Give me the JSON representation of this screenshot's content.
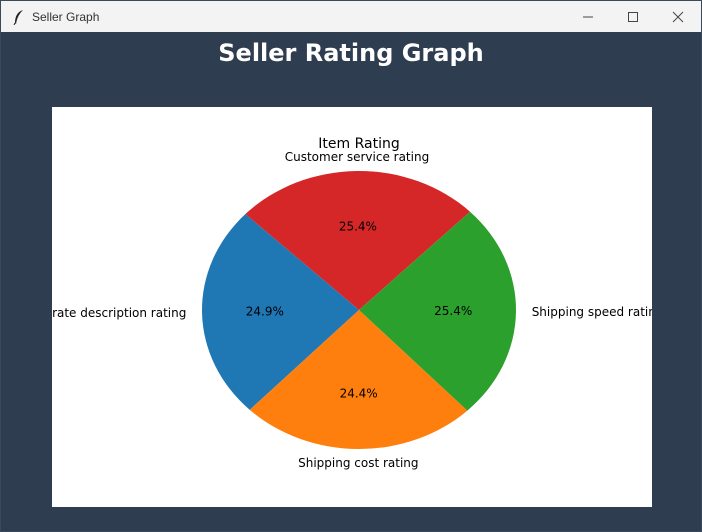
{
  "window": {
    "title": "Seller Graph",
    "icon": "feather-icon",
    "controls": [
      "minimize-icon",
      "maximize-icon",
      "close-icon"
    ]
  },
  "header": {
    "title": "Seller Rating Graph"
  },
  "chart_data": {
    "type": "pie",
    "title": "Item Rating",
    "categories": [
      "Customer service rating",
      "Item as accurate description rating",
      "Shipping cost rating",
      "Shipping speed rating"
    ],
    "values": [
      25.4,
      24.9,
      24.4,
      25.4
    ],
    "labels_pct": [
      "25.4%",
      "24.9%",
      "24.4%",
      "25.4%"
    ],
    "colors": [
      "#d62728",
      "#1f77b4",
      "#ff7f0e",
      "#2ca02c"
    ],
    "start_angle_deg": 45,
    "direction": "counterclockwise"
  },
  "colors": {
    "background": "#2e3e50",
    "titlebar": "#f3f3f3",
    "canvas": "#ffffff"
  }
}
